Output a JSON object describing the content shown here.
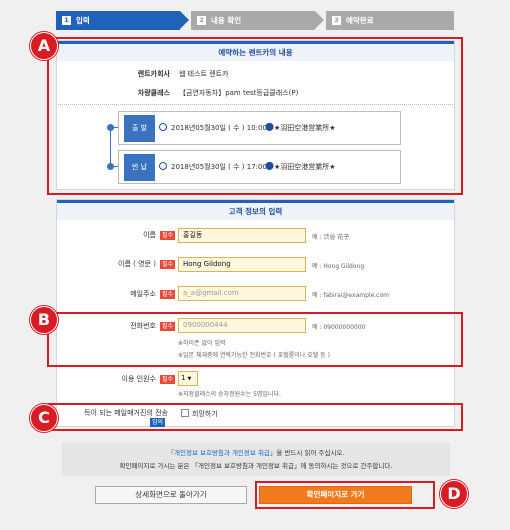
{
  "steps": [
    {
      "num": "1",
      "label": "입력"
    },
    {
      "num": "2",
      "label": "내용 확인"
    },
    {
      "num": "3",
      "label": "예약완료"
    }
  ],
  "reservation": {
    "header": "예약하는 렌트카의 내용",
    "company_label": "렌트카회사",
    "company_value": "웹 테스트 렌트카",
    "class_label": "차량클래스",
    "class_value": "【금연자동차】pam test등급클래스(P)",
    "departure": {
      "tag": "출 발",
      "datetime": "2018년05월30일 ( 수 ) 10:00",
      "place": "★羽田空港営業所★"
    },
    "return": {
      "tag": "반 납",
      "datetime": "2018년05월30일 ( 수 ) 17:00",
      "place": "★羽田空港営業所★"
    }
  },
  "customer": {
    "header": "고객 정보의 입력",
    "required_label": "필수",
    "name_label": "이름",
    "name_value": "홍길동",
    "name_hint": "예 : 渋谷 花子",
    "name_en_label": "이름 ( 영문 )",
    "name_en_value": "Hong Gildong",
    "name_en_hint": "예 : Hong Gildong",
    "email_label": "메일주소",
    "email_value": "a_a@gmail.com",
    "email_hint": "예 : fabirai@example.com",
    "phone_label": "전화번호",
    "phone_value": "0900000444",
    "phone_hint": "예 : 09000000000",
    "phone_note1": "※하이픈 없이 입력",
    "phone_note2": "※일본 체재중에 연락가능한 전화번호 ( 호텔룸이나 호텔 등 )",
    "guests_label": "이용 인원수",
    "guests_value": "1",
    "guests_note": "※지정클래스의 승차정원수는 5명입니다.",
    "newsletter_label": "득이 되는 메일매거진의 전송",
    "newsletter_badge": "임의",
    "newsletter_option": "희망하기"
  },
  "privacy": {
    "line1_link": "「개인정보 보호방침과 개인정보 취급」",
    "line1_rest": "을 반드시 읽어 주십시오.",
    "line2": "확인페이지로 가시는 분은 「개인정보 보호방침과 개인정보 취급」에 동의하시는 것으로 간주합니다."
  },
  "buttons": {
    "back": "상세화면으로 돌아가기",
    "confirm": "확인페이지로 가기"
  },
  "markers": [
    "A",
    "B",
    "C",
    "D"
  ],
  "colors": {
    "accent": "#1e63b9",
    "annotation": "#d91c24",
    "confirm": "#f07a1c"
  }
}
